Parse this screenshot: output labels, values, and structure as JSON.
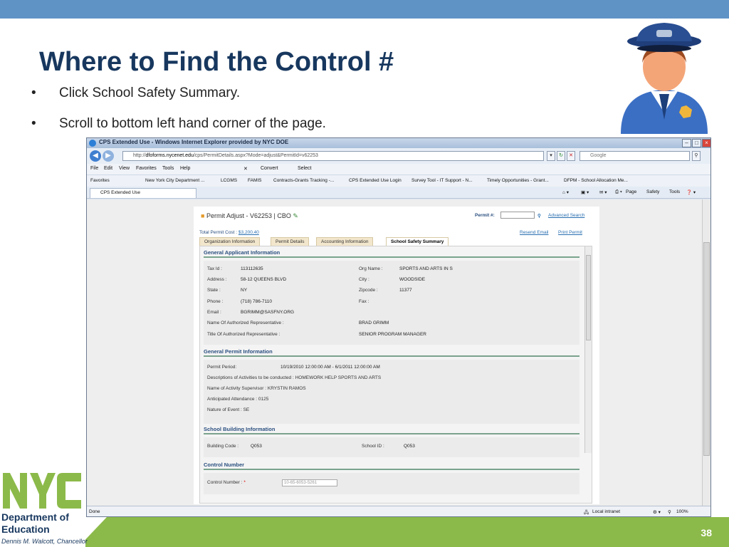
{
  "slide": {
    "title": "Where to Find the Control #",
    "bullets": [
      {
        "dot": "•",
        "text": "Click School Safety Summary."
      },
      {
        "dot": "•",
        "text": "Scroll to bottom left hand corner of the page."
      }
    ],
    "number": "38",
    "logo": {
      "line1": "Department of",
      "line2": "Education",
      "chancellor": "Dennis M. Walcott, Chancellor"
    },
    "colors": {
      "title": "#17375e",
      "band": "#5f93c6",
      "green": "#8cba4a"
    }
  },
  "browser": {
    "title": "CPS Extended Use - Windows Internet Explorer provided by NYC DOE",
    "url_prefix": "http://",
    "url_domain": "dfoforms.nycenet.edu",
    "url_path": "/cps/PermitDetails.aspx?Mode=adjust&PermitId=v62253",
    "search_placeholder": "Google",
    "menu": [
      "File",
      "Edit",
      "View",
      "Favorites",
      "Tools",
      "Help"
    ],
    "convert": "Convert",
    "select": "Select",
    "favorites_label": "Favorites",
    "favorites": [
      "New York City Department ...",
      "LCGMS",
      "FAMIS",
      "Contracts-Grants Tracking -...",
      "CPS Extended Use Login",
      "Survey Tool - IT Support - N...",
      "Timely Opportunities - Grant...",
      "DFPM - School Allocation Me..."
    ],
    "tab_label": "CPS Extended Use",
    "commands": [
      "Page",
      "Safety",
      "Tools"
    ],
    "status": {
      "left": "Done",
      "zone": "Local intranet",
      "zoom": "100%"
    }
  },
  "page": {
    "title": "Permit Adjust - V62253 | CBO",
    "permit_label": "Permit #:",
    "advanced_search": "Advanced Search",
    "total_cost_label": "Total Permit Cost :",
    "total_cost_value": "$3,200.40",
    "resend_email": "Resend Email",
    "print_permit": "Print Permit",
    "tabs": [
      "Organization Information",
      "Permit Details",
      "Accounting Information",
      "School Safety Summary"
    ],
    "applicant": {
      "heading": "General Applicant Information",
      "tax_id_label": "Tax Id :",
      "tax_id": "113112635",
      "org_name_label": "Org Name :",
      "org_name": "SPORTS AND ARTS IN S",
      "address_label": "Address :",
      "address": "58-12 QUEENS BLVD",
      "city_label": "City :",
      "city": "WOODSIDE",
      "state_label": "State :",
      "state": "NY",
      "zipcode_label": "Zipcode :",
      "zipcode": "11377",
      "phone_label": "Phone :",
      "phone": "(718) 786-7110",
      "fax_label": "Fax :",
      "email_label": "Email :",
      "email": "BGRIMM@SASFNY.ORG",
      "rep_name_label": "Name Of Authorized Representative :",
      "rep_name": "BRAD GRIMM",
      "rep_title_label": "Title Of Authorized Representative :",
      "rep_title": "SENIOR PROGRAM MANAGER"
    },
    "permit_info": {
      "heading": "General Permit Information",
      "period_label": "Permit Period:",
      "period": "10/19/2010 12:00:00 AM - 6/1/2011 12:00:00 AM",
      "activities": "Descriptions of Activities to be conducted : HOMEWORK HELP SPORTS AND ARTS",
      "supervisor": "Name of Activity Supervisor : KRYSTIN RAMOS",
      "attendance": "Anticipated Attendance : 0125",
      "nature": "Nature of Event : SE"
    },
    "building": {
      "heading": "School Building Information",
      "code_label": "Building Code :",
      "code": "Q053",
      "school_id_label": "School ID :",
      "school_id": "Q053"
    },
    "control": {
      "heading": "Control Number",
      "label": "Control Number :",
      "required": "*",
      "value": "10-65-6053-5261"
    }
  }
}
